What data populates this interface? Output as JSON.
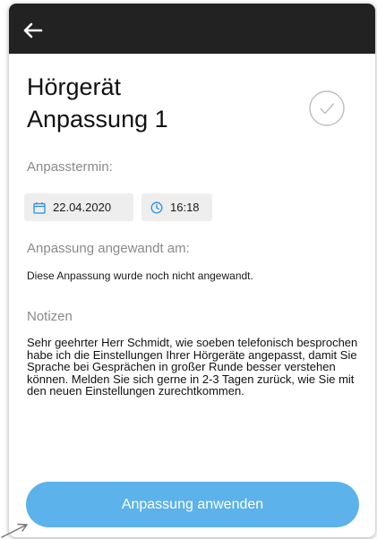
{
  "header": {
    "back_icon": "arrow-left-icon",
    "background": "#222222"
  },
  "page": {
    "title": "Hörgerät\nAnpassung 1",
    "status_icon": "check-circle-icon"
  },
  "appointment": {
    "label": "Anpasstermin:",
    "date": "22.04.2020",
    "date_icon": "calendar-icon",
    "time": "16:18",
    "time_icon": "clock-icon",
    "accent_color": "#2a8fe0"
  },
  "applied": {
    "label": "Anpassung angewandt am:",
    "value": "Diese Anpassung wurde noch nicht angewandt."
  },
  "notes": {
    "label": "Notizen",
    "text": "Sehr geehrter Herr Schmidt, wie soeben telefonisch besprochen habe ich die Einstellungen Ihrer Hörgeräte angepasst, damit Sie Sprache bei Gesprächen in großer Runde besser verstehen können. Melden Sie sich gerne in 2-3 Tagen zurück, wie Sie mit den neuen Einstellungen zurechtkommen."
  },
  "actions": {
    "apply_label": "Anpassung anwenden",
    "apply_color": "#5cb2ea"
  }
}
